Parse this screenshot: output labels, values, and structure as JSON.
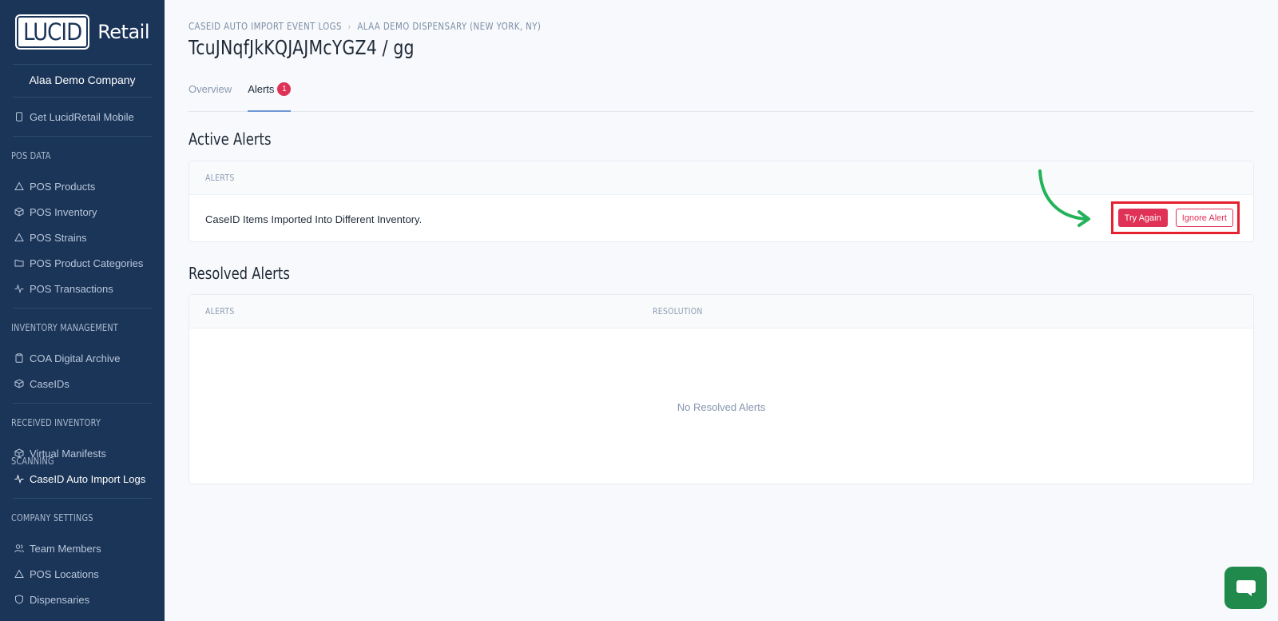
{
  "sidebar": {
    "logo_mark": "LUCID",
    "logo_text": "Retail",
    "company": "Alaa Demo Company",
    "mobile_link": "Get LucidRetail Mobile",
    "sections": [
      {
        "label": "POS DATA",
        "items": [
          {
            "label": "POS Products",
            "icon": "triangle-icon"
          },
          {
            "label": "POS Inventory",
            "icon": "box-icon"
          },
          {
            "label": "POS Strains",
            "icon": "triangle-icon"
          },
          {
            "label": "POS Product Categories",
            "icon": "folder-icon"
          },
          {
            "label": "POS Transactions",
            "icon": "activity-icon"
          }
        ]
      },
      {
        "label": "INVENTORY MANAGEMENT",
        "items": [
          {
            "label": "COA Digital Archive",
            "icon": "clipboard-icon"
          },
          {
            "label": "CaseIDs",
            "icon": "box-icon"
          }
        ]
      },
      {
        "label": "RECEIVED INVENTORY SCANNING",
        "items": [
          {
            "label": "Virtual Manifests",
            "icon": "box-icon"
          },
          {
            "label": "CaseID Auto Import Logs",
            "icon": "activity-icon"
          }
        ]
      },
      {
        "label": "COMPANY SETTINGS",
        "items": [
          {
            "label": "Team Members",
            "icon": "users-icon"
          },
          {
            "label": "POS Locations",
            "icon": "triangle-icon"
          },
          {
            "label": "Dispensaries",
            "icon": "shield-icon"
          }
        ]
      }
    ]
  },
  "header": {
    "breadcrumb": [
      "CASEID AUTO IMPORT EVENT LOGS",
      "ALAA DEMO DISPENSARY (NEW YORK, NY)"
    ],
    "title": "TcuJNqfJkKQJAJMcYGZ4 / gg"
  },
  "tabs": [
    {
      "label": "Overview"
    },
    {
      "label": "Alerts",
      "badge": "1"
    }
  ],
  "active_alerts": {
    "title": "Active Alerts",
    "column": "ALERTS",
    "rows": [
      {
        "text": "CaseID Items Imported Into Different Inventory.",
        "primary_action": "Try Again",
        "secondary_action": "Ignore Alert"
      }
    ]
  },
  "resolved_alerts": {
    "title": "Resolved Alerts",
    "columns": [
      "ALERTS",
      "RESOLUTION"
    ],
    "empty_text": "No Resolved Alerts"
  },
  "colors": {
    "sidebar_bg": "#1b3558",
    "accent_red": "#e03157",
    "highlight_box": "#e5202f",
    "annotation_arrow": "#22b35a",
    "chat_button": "#1f8a4c"
  }
}
